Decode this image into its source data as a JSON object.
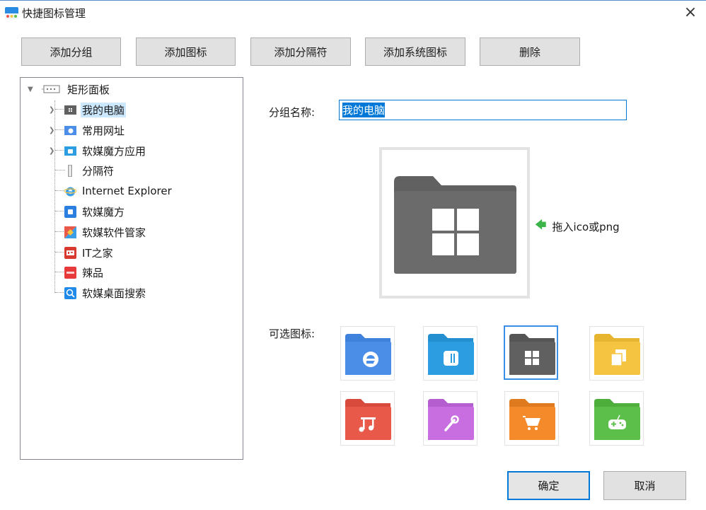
{
  "window": {
    "title": "快捷图标管理",
    "close_label": "×"
  },
  "toolbar": {
    "add_group": "添加分组",
    "add_icon": "添加图标",
    "add_separator": "添加分隔符",
    "add_system_icon": "添加系统图标",
    "delete": "删除"
  },
  "tree": {
    "root": "矩形面板",
    "items": [
      {
        "label": "我的电脑",
        "icon": "computer-icon"
      },
      {
        "label": "常用网址",
        "icon": "browser-icon"
      },
      {
        "label": "软媒魔方应用",
        "icon": "cube-icon"
      },
      {
        "label": "分隔符",
        "icon": "separator-icon"
      },
      {
        "label": "Internet Explorer",
        "icon": "ie-icon"
      },
      {
        "label": "软媒魔方",
        "icon": "cube-icon"
      },
      {
        "label": "软媒软件管家",
        "icon": "software-manager-icon"
      },
      {
        "label": "IT之家",
        "icon": "ithome-icon"
      },
      {
        "label": "辣品",
        "icon": "lapin-icon"
      },
      {
        "label": "软媒桌面搜索",
        "icon": "search-icon"
      }
    ]
  },
  "form": {
    "group_name_label": "分组名称:",
    "group_name_value": "我的电脑",
    "drop_hint": "拖入ico或png",
    "optional_icons_label": "可选图标:"
  },
  "icon_options": [
    {
      "name": "ie-folder-icon",
      "color": "#4a8ee8"
    },
    {
      "name": "cube-folder-icon",
      "color": "#2b9de0"
    },
    {
      "name": "windows-folder-icon",
      "color": "#606060"
    },
    {
      "name": "copy-folder-icon",
      "color": "#f5c542"
    },
    {
      "name": "music-folder-icon",
      "color": "#e8594a"
    },
    {
      "name": "tools-folder-icon",
      "color": "#c86ee0"
    },
    {
      "name": "shop-folder-icon",
      "color": "#f58a2a"
    },
    {
      "name": "game-folder-icon",
      "color": "#5cbf4a"
    }
  ],
  "footer": {
    "ok": "确定",
    "cancel": "取消"
  }
}
